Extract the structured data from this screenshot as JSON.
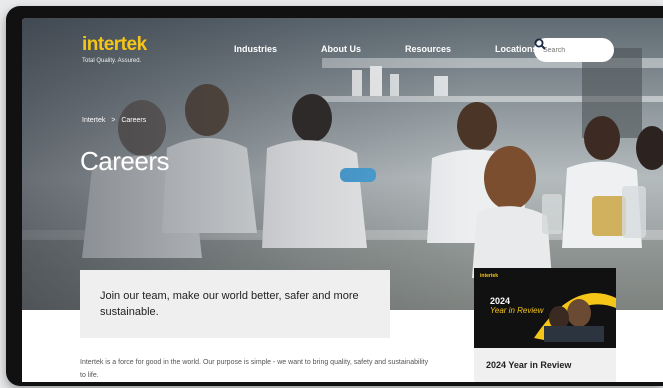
{
  "header": {
    "logo": "intertek",
    "tagline": "Total Quality. Assured.",
    "nav": [
      "Industries",
      "About Us",
      "Resources",
      "Locations"
    ],
    "search_placeholder": "Search"
  },
  "breadcrumb": [
    "Intertek",
    ">",
    "Careers"
  ],
  "page_title": "Careers",
  "intro": "Join our team, make our world better, safer and more sustainable.",
  "body_text": "Intertek is a force for good in the world. Our purpose is simple - we want to bring quality, safety and sustainability to life.",
  "review_card": {
    "brand": "intertek",
    "year": "2024",
    "thumb_caption": "Year in Review",
    "title": "2024 Year in Review"
  },
  "colors": {
    "brand": "#f5c518",
    "card": "#efeff0"
  },
  "icons": {
    "search": "search-icon"
  }
}
